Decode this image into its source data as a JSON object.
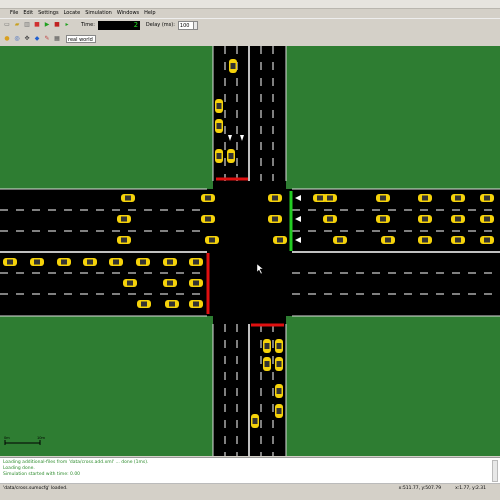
{
  "menu": [
    "File",
    "Edit",
    "Settings",
    "Locate",
    "Simulation",
    "Windows",
    "Help"
  ],
  "toolbar": {
    "time_label": "Time:",
    "time_value": "2",
    "delay_label": "Delay (ms):",
    "delay_value": "100",
    "scheme_value": "real world"
  },
  "canvas": {
    "scale_start": "0m",
    "scale_end": "10m"
  },
  "log": [
    "Loading additional-files from 'data/cross.add.xml' ... done (1ms).",
    "Loading done.",
    "Simulation started with time: 0.00"
  ],
  "status": {
    "message": "'data/cross.sumocfg' loaded.",
    "coord1": "x:511.77, y:507.79",
    "coord2": "x:1.77, y:2.31"
  },
  "colors": {
    "grass": "#2e7d32",
    "road": "#000000",
    "vehicle": "#f5d20a",
    "red_signal": "#e01010",
    "green_signal": "#22cc22"
  },
  "icons": [
    "new-file-icon",
    "open-folder-icon",
    "reload-icon",
    "close-icon",
    "play-icon",
    "stop-icon",
    "step-icon",
    "lock-icon",
    "zoom-icon",
    "locate-icon",
    "settings-icon"
  ]
}
